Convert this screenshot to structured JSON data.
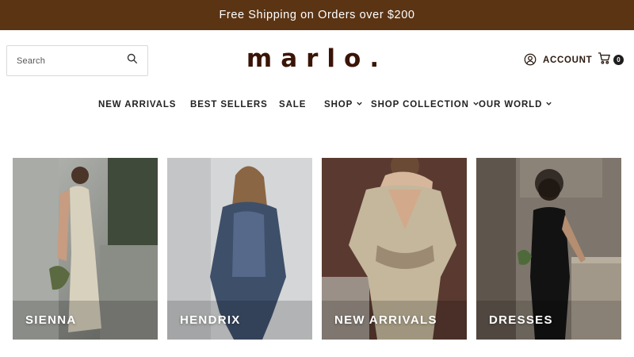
{
  "announcement": {
    "text": "Free Shipping on Orders over $200"
  },
  "header": {
    "search": {
      "placeholder": "Search",
      "icon": "search-icon"
    },
    "logo": "marlo.",
    "account": {
      "label": "ACCOUNT",
      "icon": "user-icon"
    },
    "cart": {
      "count": "0",
      "icon": "cart-icon"
    }
  },
  "nav": {
    "items": [
      {
        "label": "NEW ARRIVALS",
        "has_dropdown": false
      },
      {
        "label": "BEST SELLERS",
        "has_dropdown": false
      },
      {
        "label": "SALE",
        "has_dropdown": false
      },
      {
        "label": "SHOP",
        "has_dropdown": true
      },
      {
        "label": "SHOP COLLECTION",
        "has_dropdown": true
      },
      {
        "label": "OUR WORLD",
        "has_dropdown": true
      }
    ]
  },
  "collections": [
    {
      "label": "SIENNA"
    },
    {
      "label": "HENDRIX"
    },
    {
      "label": "NEW ARRIVALS"
    },
    {
      "label": "DRESSES"
    }
  ],
  "colors": {
    "announcement_bg": "#5b3414",
    "logo": "#3a1406",
    "text": "#2a1a10"
  }
}
